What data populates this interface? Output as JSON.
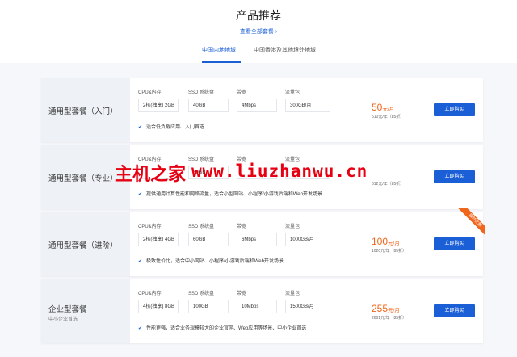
{
  "header": {
    "title": "产品推荐",
    "view_all": "查看全部套餐 ›",
    "tabs": [
      "中国内地地域",
      "中国香港及其他境外地域"
    ]
  },
  "columns": {
    "cpu": "CPU&内存",
    "ssd": "SSD 系统盘",
    "bw": "带宽",
    "traffic": "流量包"
  },
  "plans": [
    {
      "name": "通用型套餐（入门）",
      "cpu": "2核(独享) 2GB",
      "ssd": "40GB",
      "bw": "4Mbps",
      "traffic": "300GB/月",
      "desc": "适合低负载应用、入门首选",
      "price": "50",
      "unit": "元/月",
      "yearly": "510元/年（85折）",
      "buy": "立即购买"
    },
    {
      "name": "通用型套餐（专业）",
      "cpu": "",
      "ssd": "60GB",
      "bw": "",
      "traffic": "",
      "desc": "提供通用计算性能和网络流量，适合小型网站、小程序/小游戏后端和Web开发场景",
      "price": "",
      "unit": "",
      "yearly": "612元/年（85折）",
      "buy": "立即购买"
    },
    {
      "name": "通用型套餐（进阶）",
      "cpu": "2核(独享) 4GB",
      "ssd": "60GB",
      "bw": "6Mbps",
      "traffic": "1000GB/月",
      "desc": "极致性价比，适合中小网站、小程序/小游戏后端和Web开发场景",
      "price": "100",
      "unit": "元/月",
      "yearly": "1020元/年（85折）",
      "buy": "立即购买"
    },
    {
      "name": "企业型套餐",
      "sub": "中小企业首选",
      "cpu": "4核(独享) 8GB",
      "ssd": "100GB",
      "bw": "10Mbps",
      "traffic": "1500GB/月",
      "desc": "性能更强，适合业务规模较大的企业官网、Web应用等场景、中小企业首选",
      "price": "255",
      "unit": "元/月",
      "yearly": "2601元/年（85折）",
      "buy": "立即购买"
    }
  ],
  "ribbon": "限时优惠",
  "watermark": {
    "cn": "主机之家",
    "url": "www.liuzhanwu.cn"
  },
  "colors": {
    "accent": "#1a5fd6",
    "price": "#f0661c",
    "watermark": "#e60012"
  }
}
